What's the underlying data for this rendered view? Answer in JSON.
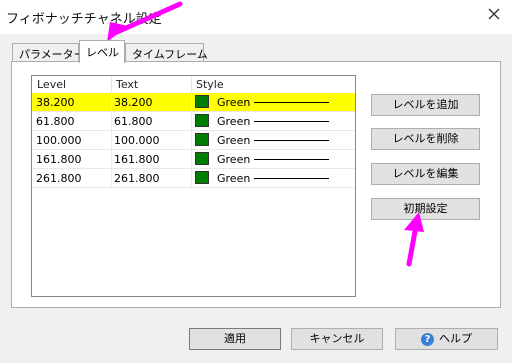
{
  "window": {
    "title": "フィボナッチチャネル設定"
  },
  "tabs": [
    {
      "label": "パラメーター"
    },
    {
      "label": "レベル"
    },
    {
      "label": "タイムフレーム"
    }
  ],
  "levels_list": {
    "columns": [
      "Level",
      "Text",
      "Style"
    ],
    "rows": [
      {
        "level": "38.200",
        "text": "38.200",
        "color": "Green",
        "selected": true
      },
      {
        "level": "61.800",
        "text": "61.800",
        "color": "Green",
        "selected": false
      },
      {
        "level": "100.000",
        "text": "100.000",
        "color": "Green",
        "selected": false
      },
      {
        "level": "161.800",
        "text": "161.800",
        "color": "Green",
        "selected": false
      },
      {
        "level": "261.800",
        "text": "261.800",
        "color": "Green",
        "selected": false
      }
    ]
  },
  "side_buttons": {
    "add": "レベルを追加",
    "delete": "レベルを削除",
    "edit": "レベルを編集",
    "reset": "初期設定"
  },
  "footer": {
    "apply": "適用",
    "cancel": "キャンセル",
    "help": "ヘルプ"
  },
  "colors": {
    "selected_row": "#ffff00",
    "swatch": "#007c00",
    "annotation_arrow": "#ff00ff"
  },
  "icons": {
    "close": "close-icon",
    "help": "help-icon",
    "annotation": "arrow-icon"
  }
}
